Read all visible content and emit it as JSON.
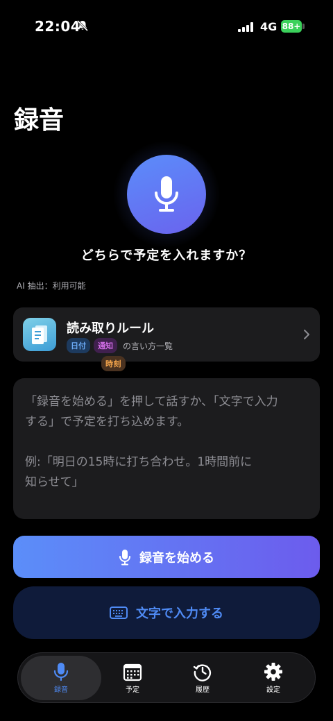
{
  "status_bar": {
    "time": "22:04",
    "network": "4G",
    "battery": "88+"
  },
  "page": {
    "title": "録音"
  },
  "prompt": {
    "question": "どちらで予定を入れますか？",
    "ai_status": "AI 抽出：利用可能"
  },
  "rules_card": {
    "title": "読み取りルール",
    "tags": [
      "日付",
      "時刻",
      "通知"
    ],
    "tags_suffix": "の言い方一覧"
  },
  "hint": {
    "lines": [
      "「録音を始める」を押して話すか、「文字で入力",
      "する」で予定を打ち込めます。"
    ],
    "example_lines": [
      "例:「明日の15時に打ち合わせ。1時間前に",
      "知らせて」"
    ]
  },
  "buttons": {
    "record": "録音を始める",
    "text_input": "文字で入力する"
  },
  "tabs": [
    {
      "label": "録音",
      "icon": "mic-icon",
      "active": true
    },
    {
      "label": "予定",
      "icon": "calendar-icon",
      "active": false
    },
    {
      "label": "履歴",
      "icon": "history-icon",
      "active": false
    },
    {
      "label": "設定",
      "icon": "gear-icon",
      "active": false
    }
  ],
  "colors": {
    "accent": "#4f8bf5",
    "gradient_start": "#5b8ef9",
    "gradient_end": "#6c5ced",
    "card": "#1c1c1e"
  }
}
